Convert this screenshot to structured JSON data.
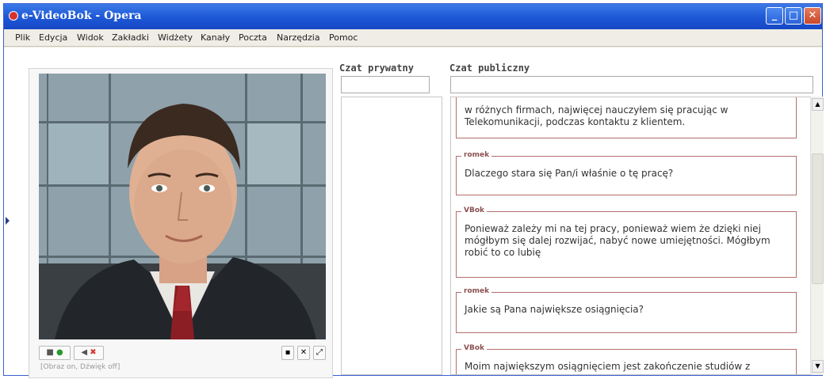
{
  "window": {
    "title": "e-VideoBok - Opera",
    "controls": {
      "minimize": "_",
      "maximize": "□",
      "close": "✕"
    }
  },
  "menu": {
    "items": [
      "Plik",
      "Edycja",
      "Widok",
      "Zakładki",
      "Widżety",
      "Kanały",
      "Poczta",
      "Narzędzia",
      "Pomoc"
    ]
  },
  "video": {
    "camera_icon": "camera-icon",
    "speaker_icon": "speaker-icon",
    "status": "[Obraz on, Dźwięk off]",
    "window_controls": [
      "▪",
      "✕",
      "⤢"
    ]
  },
  "private_chat": {
    "title": "Czat prywatny"
  },
  "public_chat": {
    "title": "Czat publiczny",
    "messages": [
      {
        "author": "",
        "text": "w różnych firmach, najwięcej nauczyłem się pracując w Telekomunikacji, podczas kontaktu z klientem."
      },
      {
        "author": "romek",
        "text": "Dlaczego stara się Pan/i właśnie o tę pracę?"
      },
      {
        "author": "VBok",
        "text": "Ponieważ zależy mi na tej pracy, ponieważ wiem że dzięki niej mógłbym się dalej rozwijać, nabyć nowe umiejętności. Mógłbym robić to co lubię"
      },
      {
        "author": "romek",
        "text": "Jakie są Pana największe osiągnięcia?"
      },
      {
        "author": "VBok",
        "text": "Moim największym osiągnięciem jest zakończenie studiów z"
      }
    ]
  },
  "colors": {
    "titlebar": "#1d57d6",
    "message_border": "#b56d6d",
    "accent_green": "#2a9b2a",
    "accent_red": "#d7322c"
  }
}
